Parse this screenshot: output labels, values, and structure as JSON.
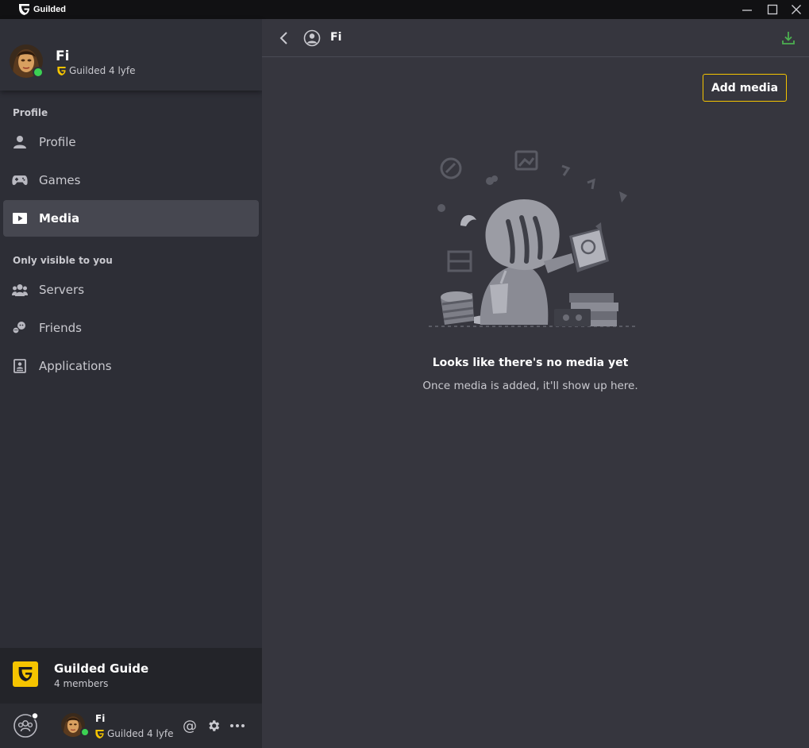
{
  "app": {
    "title": "Guilded"
  },
  "profile": {
    "name": "Fi",
    "subtitle": "Guilded 4 lyfe"
  },
  "sidebar": {
    "section_profile": "Profile",
    "section_private": "Only visible to you",
    "items": [
      {
        "label": "Profile",
        "icon": "person-icon"
      },
      {
        "label": "Games",
        "icon": "gamepad-icon"
      },
      {
        "label": "Media",
        "icon": "media-play-icon",
        "active": true
      },
      {
        "label": "Servers",
        "icon": "group-icon"
      },
      {
        "label": "Friends",
        "icon": "friends-icon"
      },
      {
        "label": "Applications",
        "icon": "application-icon"
      }
    ]
  },
  "server": {
    "name": "Guilded Guide",
    "members": "4 members"
  },
  "bottom": {
    "name": "Fi",
    "subtitle": "Guilded 4 lyfe"
  },
  "header": {
    "title": "Fi"
  },
  "main": {
    "add_media_label": "Add media",
    "empty_title": "Looks like there's no media yet",
    "empty_subtitle": "Once media is added, it'll show up here."
  },
  "colors": {
    "accent": "#f5c400",
    "online": "#3bd153",
    "download": "#4caf50"
  }
}
